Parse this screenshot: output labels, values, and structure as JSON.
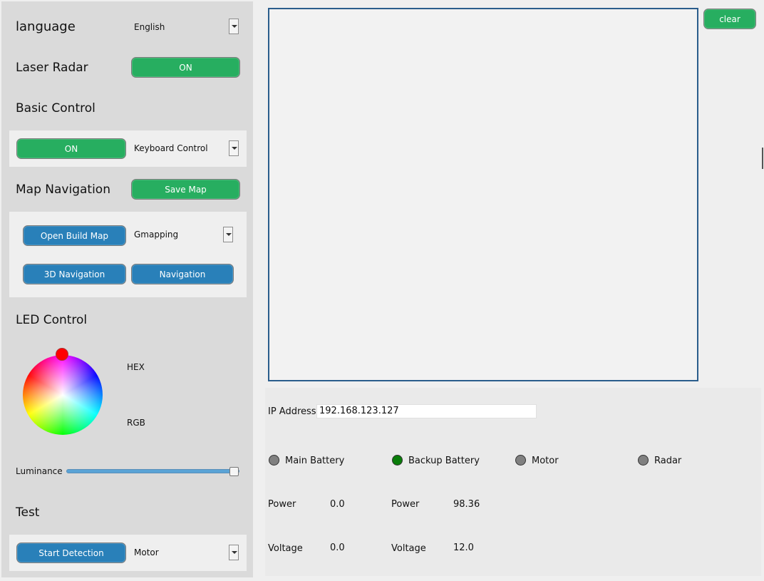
{
  "settings": {
    "language_label": "language",
    "language_value": "English",
    "laser_radar_label": "Laser Radar",
    "laser_radar_button": "ON"
  },
  "basic_control": {
    "title": "Basic Control",
    "toggle_button": "ON",
    "mode_value": "Keyboard Control"
  },
  "map_navigation": {
    "title": "Map Navigation",
    "save_button": "Save Map",
    "open_build_button": "Open Build Map",
    "algorithm_value": "Gmapping",
    "nav3d_button": "3D Navigation",
    "nav_button": "Navigation"
  },
  "led_control": {
    "title": "LED Control",
    "hex_label": "HEX",
    "rgb_label": "RGB",
    "luminance_label": "Luminance",
    "luminance_level": 1.0,
    "picker_color": "#ff0000"
  },
  "test": {
    "title": "Test",
    "start_button": "Start Detection",
    "target_value": "Motor"
  },
  "display": {
    "clear_button": "clear"
  },
  "status": {
    "ip_label": "IP Address",
    "ip_value": "192.168.123.127",
    "indicators": [
      {
        "label": "Main Battery",
        "color": "#808080"
      },
      {
        "label": "Backup Battery",
        "color": "#0a7d0a"
      },
      {
        "label": "Motor",
        "color": "#808080"
      },
      {
        "label": "Radar",
        "color": "#808080"
      }
    ],
    "main": {
      "power_label": "Power",
      "power_value": "0.0",
      "voltage_label": "Voltage",
      "voltage_value": "0.0"
    },
    "backup": {
      "power_label": "Power",
      "power_value": "98.36",
      "voltage_label": "Voltage",
      "voltage_value": "12.0"
    }
  },
  "colors": {
    "green": "#27ae60",
    "blue": "#2980b9",
    "led_on": "#0a7d0a",
    "led_off": "#808080"
  }
}
